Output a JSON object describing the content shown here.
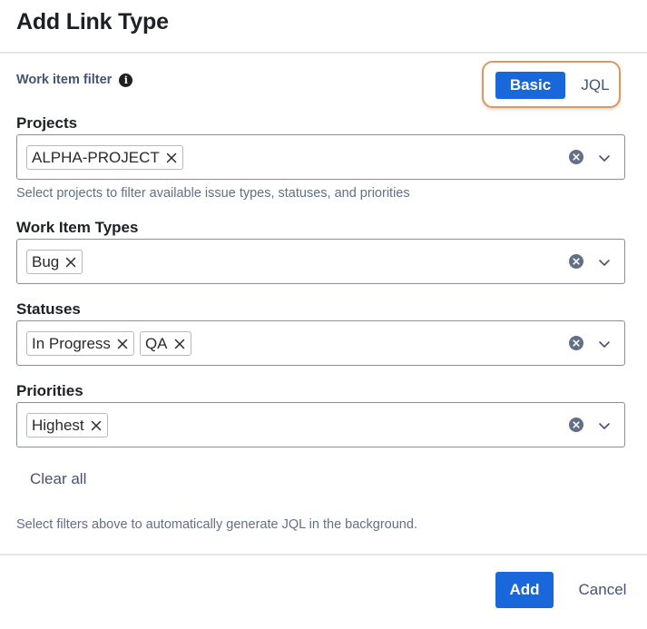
{
  "dialog": {
    "title": "Add Link Type"
  },
  "filter": {
    "label": "Work item filter",
    "info_icon": "info-icon",
    "modes": {
      "basic_label": "Basic",
      "jql_label": "JQL",
      "selected": "Basic"
    }
  },
  "fields": {
    "projects": {
      "label": "Projects",
      "chips": [
        "ALPHA-PROJECT"
      ],
      "helper": "Select projects to filter available issue types, statuses, and priorities"
    },
    "work_item_types": {
      "label": "Work Item Types",
      "chips": [
        "Bug"
      ]
    },
    "statuses": {
      "label": "Statuses",
      "chips": [
        "In Progress",
        "QA"
      ]
    },
    "priorities": {
      "label": "Priorities",
      "chips": [
        "Highest"
      ]
    }
  },
  "actions": {
    "clear_all_label": "Clear all",
    "jql_helper": "Select filters above to automatically generate JQL in the background.",
    "add_label": "Add",
    "cancel_label": "Cancel"
  },
  "colors": {
    "primary": "#1868db",
    "toggle_outline": "#d89a5e",
    "border": "#8c8f97",
    "subtle_text": "#626f86"
  }
}
